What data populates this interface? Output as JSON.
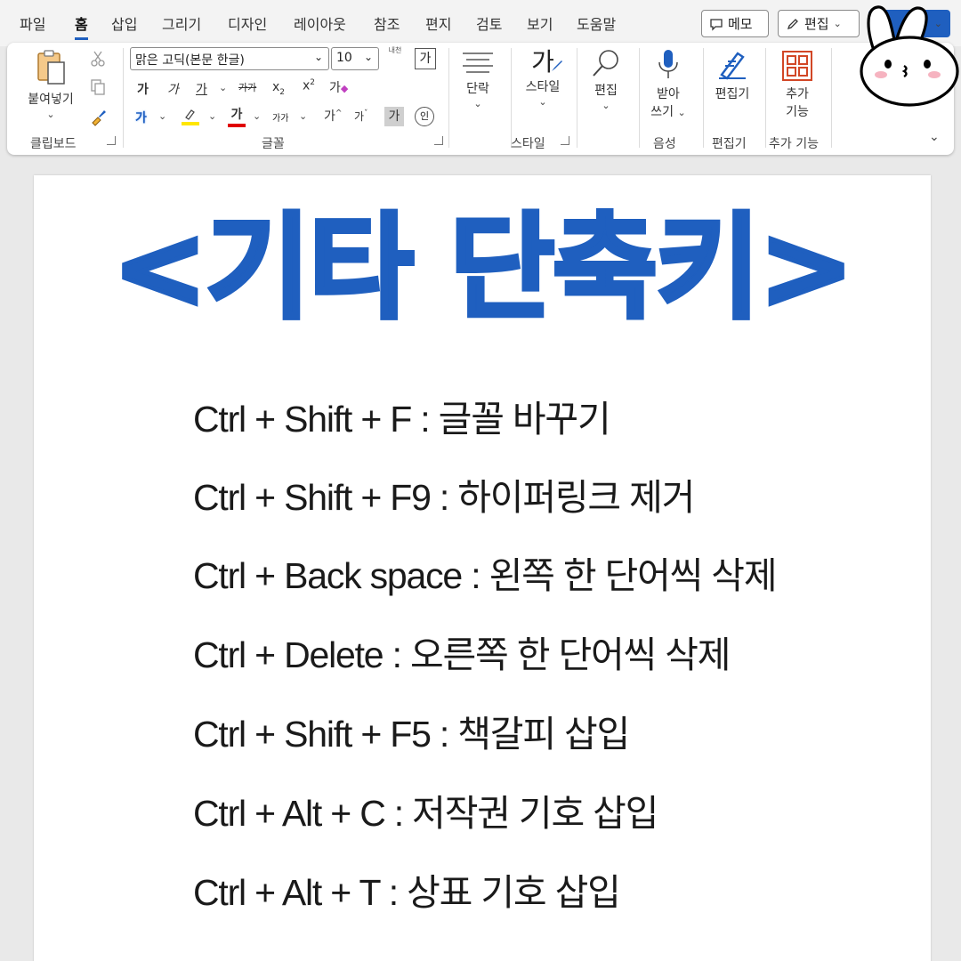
{
  "menu": {
    "tabs": [
      "파일",
      "홈",
      "삽입",
      "그리기",
      "디자인",
      "레이아웃",
      "참조",
      "편지",
      "검토",
      "보기",
      "도움말"
    ],
    "active_tab": "홈",
    "memo_label": "메모",
    "edit_label": "편집"
  },
  "ribbon": {
    "clipboard": {
      "paste_label": "붙여넣기",
      "group_label": "클립보드"
    },
    "font": {
      "font_name": "맑은 고딕(본문 한글)",
      "font_size": "10",
      "group_label": "글꼴",
      "glyph": "가",
      "glyph_small": "가가",
      "enclose": "인",
      "grow_hint": "내천"
    },
    "paragraph": {
      "label": "단락"
    },
    "styles": {
      "label": "스타일",
      "group_label": "스타일",
      "glyph": "가"
    },
    "editing": {
      "label": "편집"
    },
    "voice": {
      "label_top": "받아",
      "label_bottom": "쓰기",
      "group_label": "음성"
    },
    "editor": {
      "label": "편집기",
      "group_label": "편집기"
    },
    "addins": {
      "label_top": "추가",
      "label_bottom": "기능",
      "group_label": "추가 기능"
    },
    "colors": {
      "accent": "#1f5fbf",
      "highlight": "#ffe600",
      "font_color": "#e00000"
    }
  },
  "document": {
    "title": "<기타 단축키>",
    "shortcuts": [
      "Ctrl + Shift + F : 글꼴 바꾸기",
      "Ctrl + Shift + F9 : 하이퍼링크 제거",
      "Ctrl + Back space : 왼쪽 한 단어씩 삭제",
      "Ctrl + Delete : 오른쪽 한 단어씩 삭제",
      "Ctrl + Shift + F5 : 책갈피 삽입",
      "Ctrl + Alt + C : 저작권 기호 삽입",
      "Ctrl + Alt + T : 상표 기호 삽입"
    ]
  }
}
